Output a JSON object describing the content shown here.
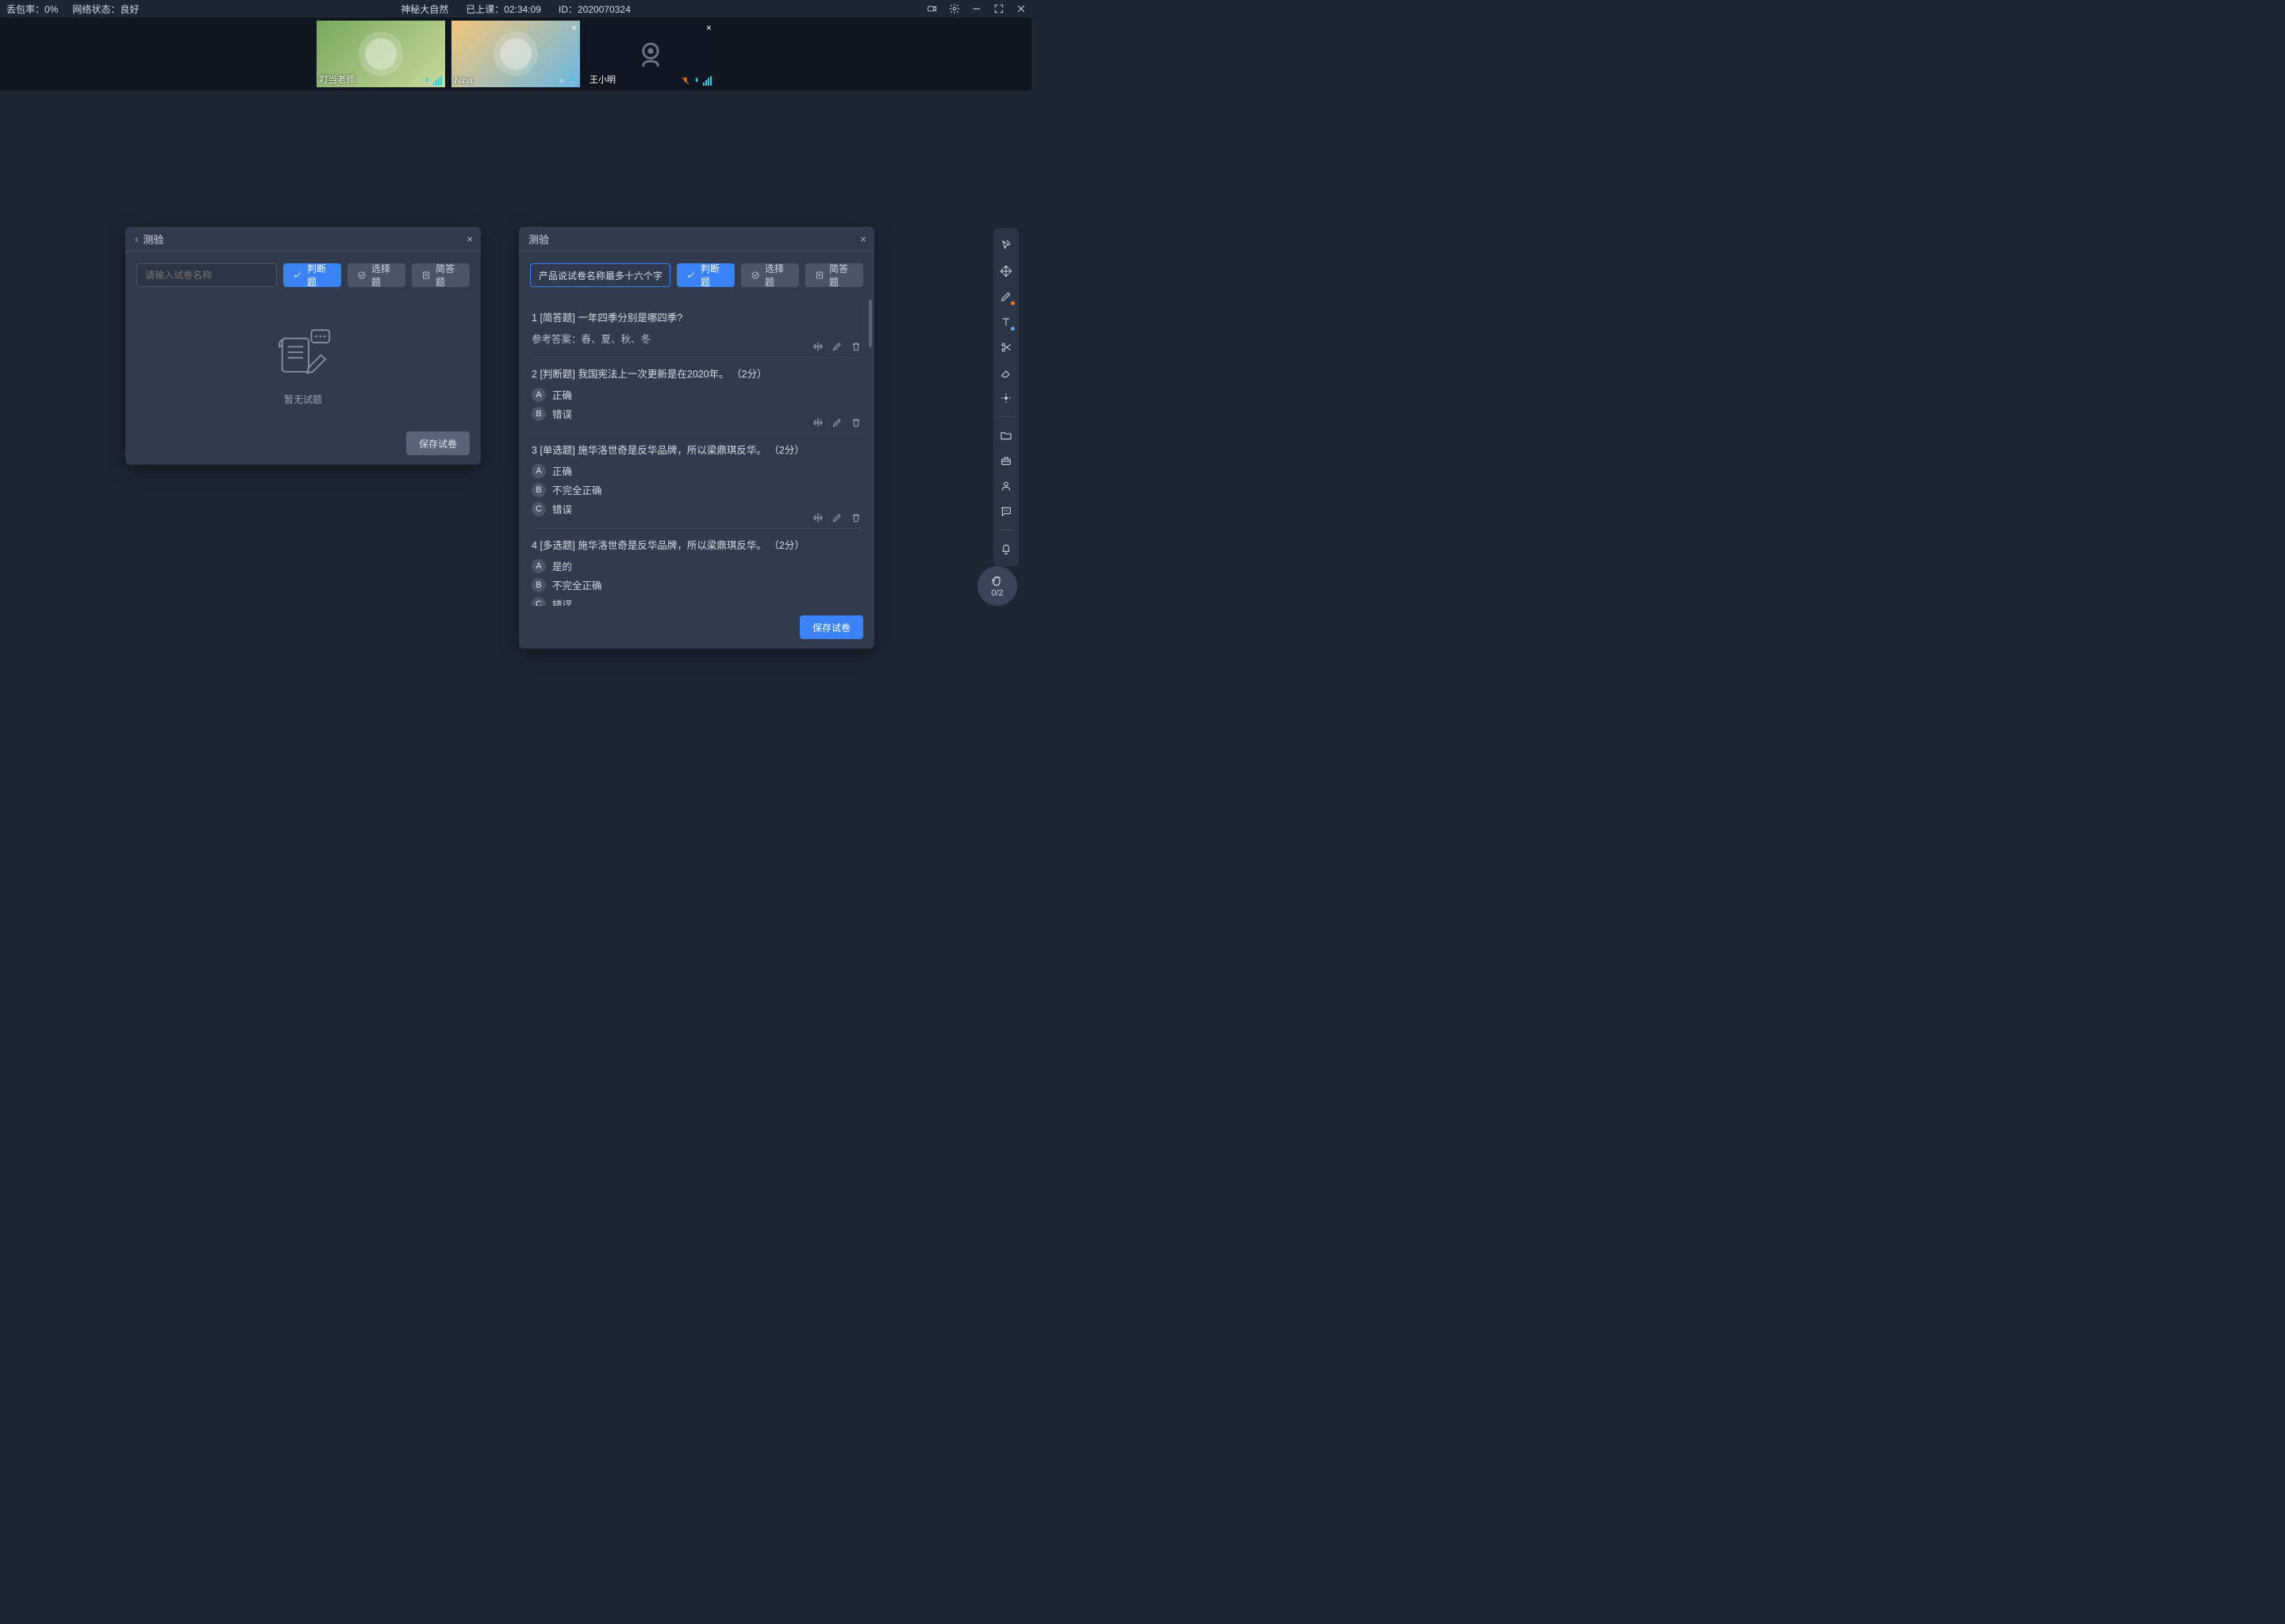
{
  "topbar": {
    "loss_label": "丢包率：",
    "loss_value": "0%",
    "network_label": "网络状态：",
    "network_value": "良好",
    "title": "神秘大自然",
    "duration_label": "已上课：",
    "duration_value": "02:34:09",
    "id_label": "ID：",
    "id_value": "2020070324"
  },
  "videos": [
    {
      "name": "叮当老师",
      "camera_on": true,
      "closeable": false
    },
    {
      "name": "Nina",
      "camera_on": true,
      "closeable": true
    },
    {
      "name": "王小明",
      "camera_on": false,
      "closeable": true
    }
  ],
  "panel_left": {
    "title": "测验",
    "input_placeholder": "请输入试卷名称",
    "btn_judge": "判断题",
    "btn_choice": "选择题",
    "btn_short": "简答题",
    "empty_text": "暂无试题",
    "save": "保存试卷"
  },
  "panel_right": {
    "title": "测验",
    "input_value": "产品说试卷名称最多十六个字",
    "btn_judge": "判断题",
    "btn_choice": "选择题",
    "btn_short": "简答题",
    "save": "保存试卷",
    "answer_prefix": "参考答案：",
    "questions": [
      {
        "num": "1",
        "tag": "[简答题]",
        "text": "一年四季分别是哪四季?",
        "answer": "春、夏、秋、冬"
      },
      {
        "num": "2",
        "tag": "[判断题]",
        "text": "我国宪法上一次更新是在2020年。",
        "score": "（2分）",
        "options": [
          {
            "k": "A",
            "v": "正确"
          },
          {
            "k": "B",
            "v": "错误"
          }
        ]
      },
      {
        "num": "3",
        "tag": "[单选题]",
        "text": "施华洛世奇是反华品牌，所以梁鼎琪反华。",
        "score": "（2分）",
        "options": [
          {
            "k": "A",
            "v": "正确"
          },
          {
            "k": "B",
            "v": "不完全正确"
          },
          {
            "k": "C",
            "v": "错误"
          }
        ]
      },
      {
        "num": "4",
        "tag": "[多选题]",
        "text": "施华洛世奇是反华品牌，所以梁鼎琪反华。",
        "score": "（2分）",
        "options": [
          {
            "k": "A",
            "v": "是的"
          },
          {
            "k": "B",
            "v": "不完全正确"
          },
          {
            "k": "C",
            "v": "错误"
          }
        ]
      }
    ]
  },
  "hand": {
    "count": "0/2"
  },
  "side_tools": [
    "cursor",
    "move",
    "pen",
    "text",
    "scissors",
    "eraser",
    "point",
    "folder",
    "toolbox",
    "person",
    "chat",
    "bell"
  ]
}
